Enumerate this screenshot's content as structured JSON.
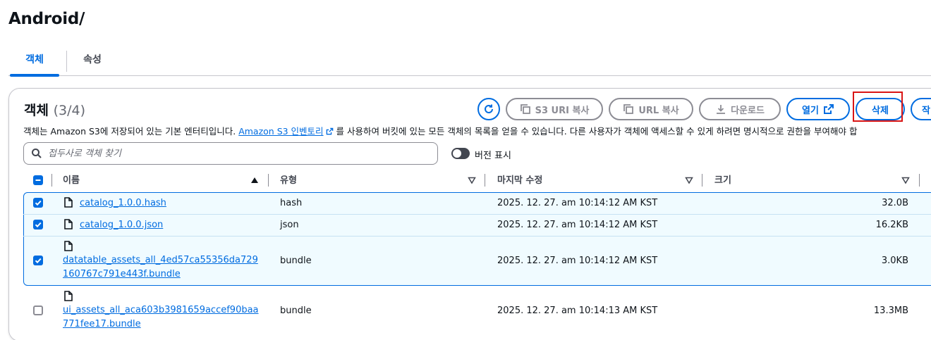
{
  "page": {
    "title": "Android/"
  },
  "tabs": [
    {
      "label": "객체"
    },
    {
      "label": "속성"
    }
  ],
  "panel": {
    "title": "객체",
    "count": "(3/4)",
    "desc_before": "객체는 Amazon S3에 저장되어 있는 기본 엔터티입니다. ",
    "desc_link": "Amazon S3 인벤토리",
    "desc_after": " 를 사용하여 버킷에 있는 모든 객체의 목록을 얻을 수 있습니다. 다른 사용자가 객체에 액세스할 수 있게 하려면 명시적으로 권한을 부여해야 합"
  },
  "toolbar": {
    "copy_s3_uri": "S3 URI 복사",
    "copy_url": "URL 복사",
    "download": "다운로드",
    "open": "열기",
    "delete": "삭제"
  },
  "search": {
    "placeholder": "접두사로 객체 찾기"
  },
  "version_toggle": {
    "label": "버전 표시",
    "on": false
  },
  "table": {
    "columns": {
      "name": "이름",
      "type": "유형",
      "modified": "마지막 수정",
      "size": "크기"
    },
    "rows": [
      {
        "name": "catalog_1.0.0.hash",
        "name_line2": "",
        "type": "hash",
        "modified": "2025. 12. 27. am 10:14:12 AM KST",
        "size": "32.0B",
        "checked": true
      },
      {
        "name": "catalog_1.0.0.json",
        "name_line2": "",
        "type": "json",
        "modified": "2025. 12. 27. am 10:14:12 AM KST",
        "size": "16.2KB",
        "checked": true
      },
      {
        "name": "datatable_assets_all_4ed57ca55356da729",
        "name_line2": "160767c791e443f.bundle",
        "type": "bundle",
        "modified": "2025. 12. 27. am 10:14:12 AM KST",
        "size": "3.0KB",
        "checked": true
      },
      {
        "name": "ui_assets_all_aca603b3981659accef90baa",
        "name_line2": "771fee17.bundle",
        "type": "bundle",
        "modified": "2025. 12. 27. am 10:14:13 AM KST",
        "size": "13.3MB",
        "checked": false
      }
    ]
  },
  "colors": {
    "accent": "#006ce0",
    "highlight": "#d91515",
    "selected_bg": "#f0fbff"
  }
}
